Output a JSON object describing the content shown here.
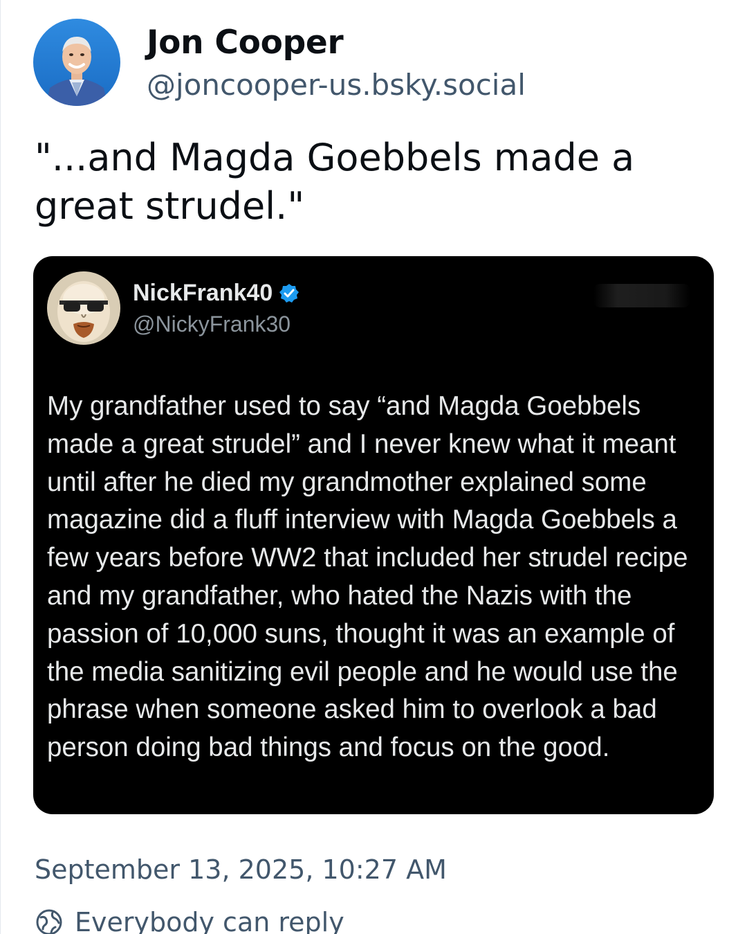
{
  "post": {
    "author_name": "Jon Cooper",
    "author_handle": "@joncooper-us.bsky.social",
    "avatar_icon": "profile-photo",
    "text": "\"...and Magda Goebbels made a great strudel.\"",
    "timestamp": "September 13, 2025, 10:27 AM",
    "reply_setting": "Everybody can reply",
    "reply_setting_icon": "globe-icon"
  },
  "quoted": {
    "name": "NickFrank40",
    "handle": "@NickyFrank30",
    "verified": true,
    "verified_color": "#1d9bf0",
    "avatar_icon": "cartoon-avatar",
    "text": "My grandfather used to say “and Magda Goebbels made a great strudel” and I never knew what it meant until after he died my grandmother explained some magazine did a fluff interview with Magda Goebbels a few years before WW2 that included her strudel recipe and my grandfather, who hated the Nazis with the passion of 10,000 suns, thought it was an example of the media sanitizing evil people and he would use the phrase when someone asked him to overlook a bad person doing bad things and focus on the good."
  },
  "colors": {
    "primary_text": "#0b0f14",
    "secondary_text": "#42576c",
    "embed_background": "#000000",
    "embed_text": "#e7e9ea",
    "embed_secondary_text": "#8b949c"
  }
}
